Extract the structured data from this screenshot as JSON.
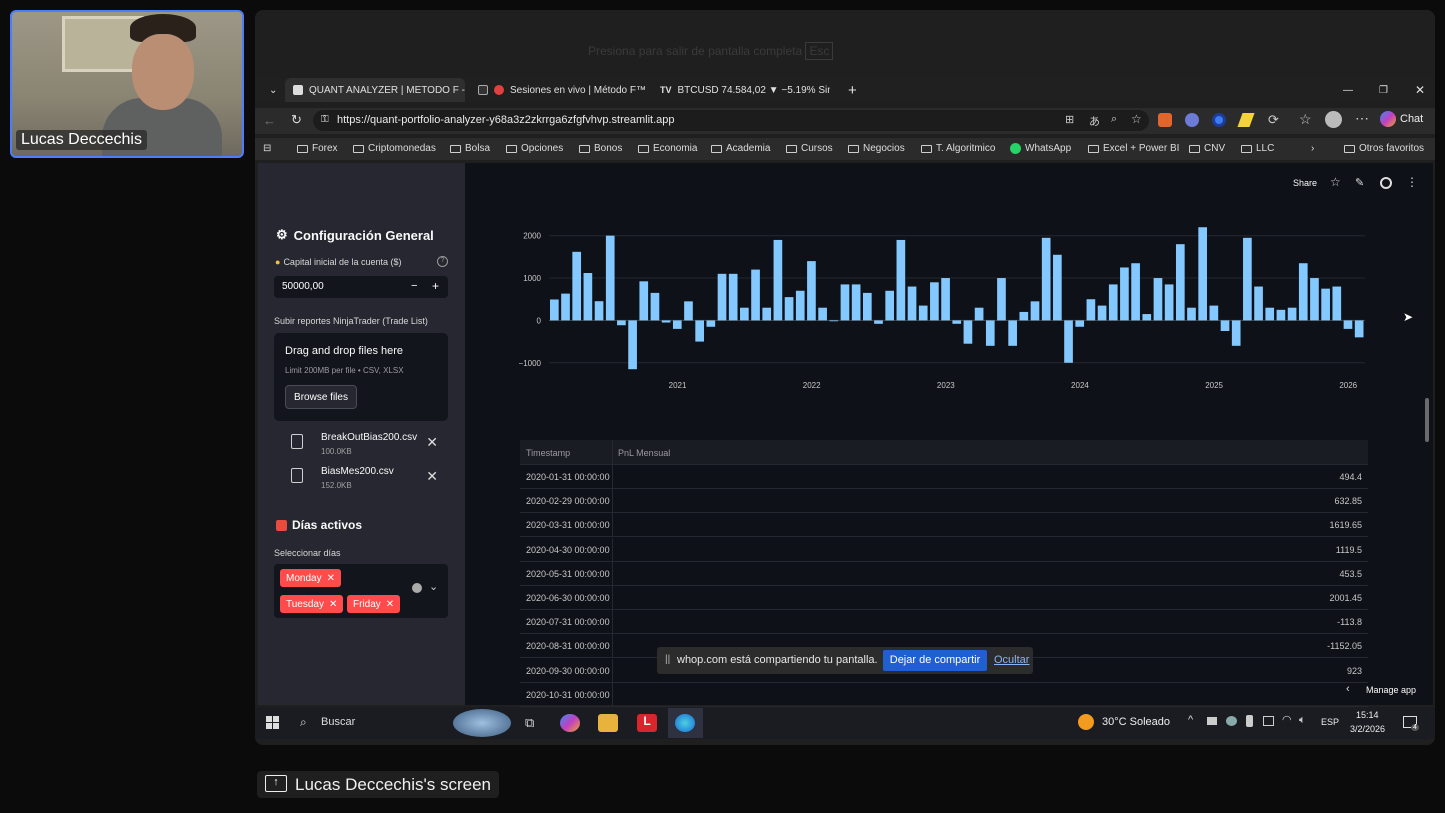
{
  "webcam": {
    "participant_name": "Lucas Deccechis"
  },
  "share": {
    "hint_text": "Presiona para salir de pantalla completa",
    "hint_key": "Esc",
    "screen_label": "Lucas Deccechis's screen"
  },
  "browser": {
    "tabs": [
      {
        "label": "QUANT ANALYZER | METODO F - S",
        "active": true
      },
      {
        "label": "Sesiones en vivo | Método F™",
        "active": false
      },
      {
        "label": "BTCUSD 74.584,02 ▼ −5.19% Sin n",
        "active": false
      }
    ],
    "url": "https://quant-portfolio-analyzer-y68a3z2zkrrga6zfgfvhvp.streamlit.app",
    "chat_label": "Chat",
    "bookmarks": [
      "Forex",
      "Criptomonedas",
      "Bolsa",
      "Opciones",
      "Bonos",
      "Economia",
      "Academia",
      "Cursos",
      "Negocios",
      "T. Algoritmico",
      "WhatsApp",
      "Excel + Power BI",
      "CNV",
      "LLC"
    ],
    "other_favorites": "Otros favoritos"
  },
  "app": {
    "toolbar": {
      "share_label": "Share"
    },
    "sidebar": {
      "config_title": "Configuración General",
      "capital_label": "Capital inicial de la cuenta ($)",
      "capital_value": "50000,00",
      "minus": "−",
      "plus": "+",
      "upload_label": "Subir reportes NinjaTrader (Trade List)",
      "drag_drop": "Drag and drop files here",
      "limit_text": "Limit 200MB per file • CSV, XLSX",
      "browse_button": "Browse files",
      "files": [
        {
          "name": "BreakOutBias200.csv",
          "size": "100.0KB"
        },
        {
          "name": "BiasMes200.csv",
          "size": "152.0KB"
        }
      ],
      "days_title": "Días activos",
      "days_label": "Seleccionar días",
      "selected_days": [
        "Monday",
        "Tuesday",
        "Friday"
      ]
    },
    "table": {
      "headers": [
        "Timestamp",
        "PnL Mensual"
      ],
      "rows": [
        [
          "2020-01-31 00:00:00",
          "494.4"
        ],
        [
          "2020-02-29 00:00:00",
          "632.85"
        ],
        [
          "2020-03-31 00:00:00",
          "1619.65"
        ],
        [
          "2020-04-30 00:00:00",
          "1119.5"
        ],
        [
          "2020-05-31 00:00:00",
          "453.5"
        ],
        [
          "2020-06-30 00:00:00",
          "2001.45"
        ],
        [
          "2020-07-31 00:00:00",
          "-113.8"
        ],
        [
          "2020-08-31 00:00:00",
          "-1152.05"
        ],
        [
          "2020-09-30 00:00:00",
          "923"
        ],
        [
          "2020-10-31 00:00:00",
          ""
        ]
      ]
    },
    "manage_app": "Manage app"
  },
  "chart_data": {
    "type": "bar",
    "ylim": [
      -1100,
      2300
    ],
    "yticks": [
      "2000",
      "1000",
      "0",
      "−1000"
    ],
    "xticks": [
      "2021",
      "2022",
      "2023",
      "2024",
      "2025",
      "2026"
    ],
    "color": "#83c9ff",
    "values": [
      494.4,
      632.85,
      1619.65,
      1119.5,
      453.5,
      2001.45,
      -113.8,
      -1152.05,
      923,
      650,
      -50,
      -200,
      450,
      -500,
      -150,
      1100,
      1100,
      300,
      1200,
      300,
      1900,
      550,
      700,
      1400,
      300,
      -20,
      850,
      850,
      650,
      -80,
      700,
      1900,
      800,
      350,
      900,
      1000,
      -80,
      -550,
      300,
      -600,
      1000,
      -600,
      200,
      450,
      1950,
      1550,
      -1000,
      -150,
      500,
      350,
      850,
      1250,
      1350,
      150,
      1000,
      850,
      1800,
      300,
      2200,
      350,
      -250,
      -600,
      1950,
      800,
      300,
      250,
      300,
      1350,
      1000,
      750,
      800,
      -200,
      -400
    ]
  },
  "share_banner": {
    "text": "whop.com está compartiendo tu pantalla.",
    "stop_button": "Dejar de compartir",
    "hide_link": "Ocultar"
  },
  "taskbar": {
    "search_placeholder": "Buscar",
    "weather": "30°C  Soleado",
    "lang": "ESP",
    "time": "15:14",
    "date": "3/2/2026",
    "notif_count": "4"
  }
}
